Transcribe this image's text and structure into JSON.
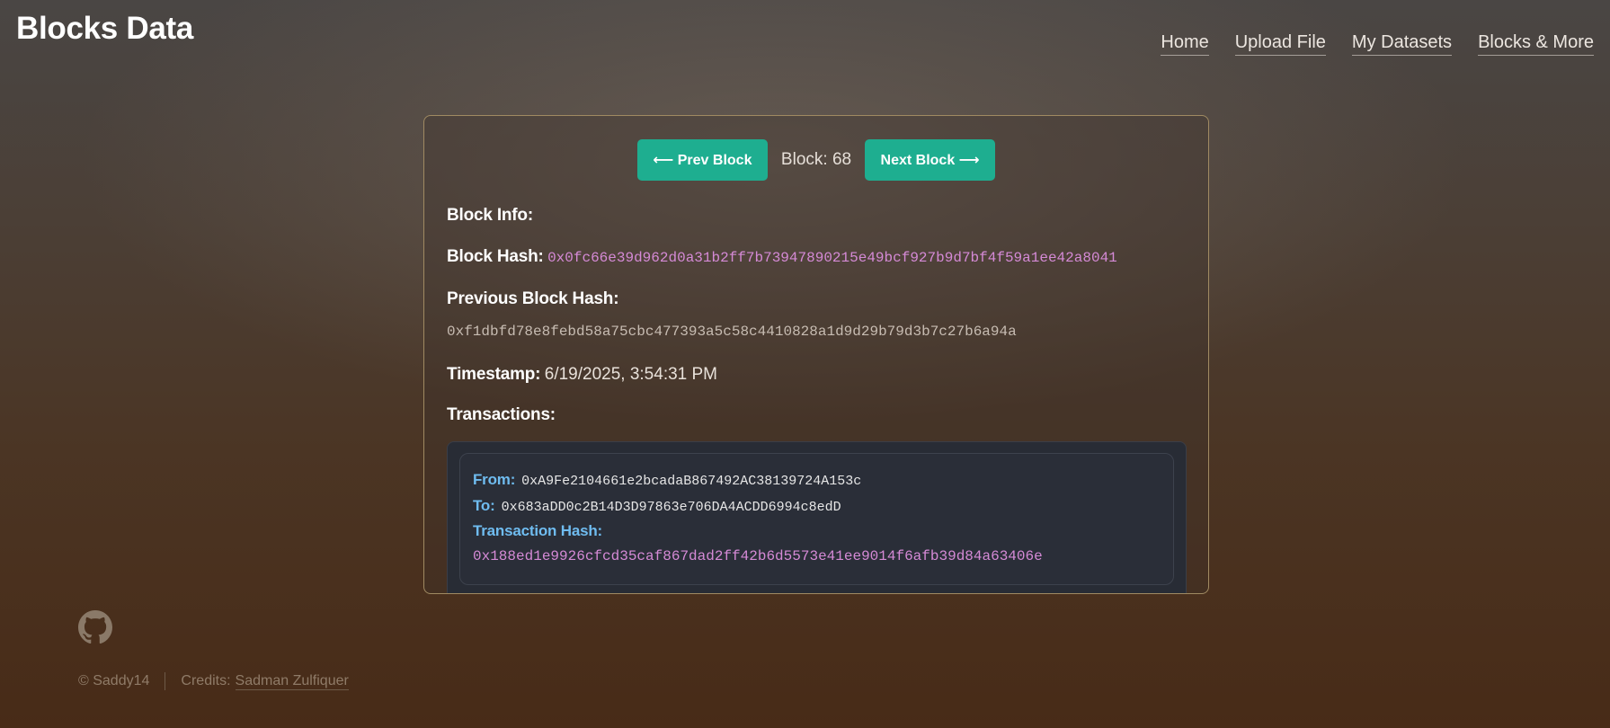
{
  "header": {
    "title": "Blocks Data",
    "nav": [
      {
        "label": "Home"
      },
      {
        "label": "Upload File"
      },
      {
        "label": "My Datasets"
      },
      {
        "label": "Blocks & More"
      }
    ]
  },
  "pager": {
    "prev_label": "⟵ Prev Block",
    "block_text": "Block: 68",
    "next_label": "Next Block ⟶"
  },
  "block": {
    "info_label": "Block Info:",
    "hash_label": "Block Hash:",
    "hash_value": "0x0fc66e39d962d0a31b2ff7b73947890215e49bcf927b9d7bf4f59a1ee42a8041",
    "prev_hash_label": "Previous Block Hash:",
    "prev_hash_value": "0xf1dbfd78e8febd58a75cbc477393a5c58c4410828a1d9d29b79d3b7c27b6a94a",
    "timestamp_label": "Timestamp:",
    "timestamp_value": "6/19/2025, 3:54:31 PM",
    "transactions_label": "Transactions:"
  },
  "transactions": [
    {
      "from_label": "From:",
      "from_value": "0xA9Fe2104661e2bcadaB867492AC38139724A153c",
      "to_label": "To:",
      "to_value": "0x683aDD0c2B14D3D97863e706DA4ACDD6994c8edD",
      "hash_label": "Transaction Hash:",
      "hash_value": "0x188ed1e9926cfcd35caf867dad2ff42b6d5573e41ee9014f6afb39d84a63406e"
    }
  ],
  "footer": {
    "github_icon": "github-icon",
    "copyright": "© Saddy14",
    "credits_label": "Credits:",
    "credits_link": "Sadman Zulfiquer"
  },
  "colors": {
    "accent": "#1eae90",
    "hash": "#d58ad6",
    "tx_label": "#6fbcf0"
  }
}
